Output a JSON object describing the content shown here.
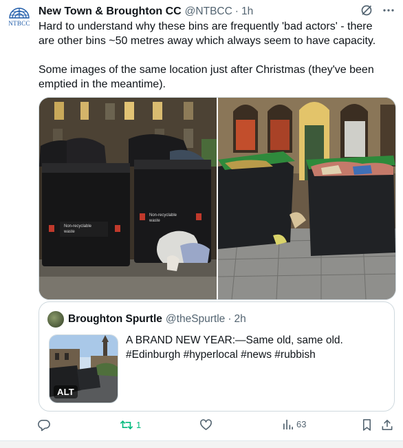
{
  "tweet": {
    "author_name": "New Town & Broughton CC",
    "author_handle": "@NTBCC",
    "separator": "·",
    "time": "1h",
    "avatar_text": "NTBCC",
    "text": "Hard to understand why these bins are frequently 'bad actors' - there are other bins ~50 metres away which always seem to have capacity.\n\nSome images of the same location just after Christmas (they've been emptied in the meantime).",
    "media": [
      {
        "description": "Black bins overflowing with rubbish bags at night",
        "bin_label": "Non-recyclable waste"
      },
      {
        "description": "Black bins with green lids full of litter outside townhouses",
        "bin_label": ""
      }
    ]
  },
  "quote": {
    "author_name": "Broughton Spurtle",
    "author_handle": "@theSpurtle",
    "separator": "·",
    "time": "2h",
    "text": "A BRAND NEW YEAR:—Same old, same old.\n#Edinburgh #hyperlocal #news #rubbish",
    "thumb_badge": "ALT"
  },
  "actions": {
    "reply_count": "",
    "retweet_count": "1",
    "like_count": "",
    "views_count": "63"
  },
  "icons": [
    "grok-slash-icon",
    "more-icon",
    "reply-icon",
    "retweet-icon",
    "like-icon",
    "views-icon",
    "bookmark-icon",
    "share-icon"
  ],
  "colors": {
    "text": "#0f1419",
    "muted": "#536471",
    "retweet": "#00ba7c",
    "border": "#cfd9de"
  }
}
